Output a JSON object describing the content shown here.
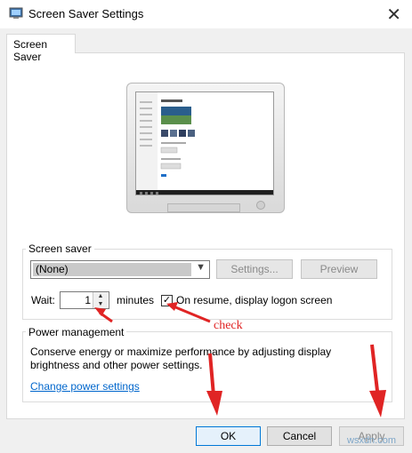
{
  "window": {
    "title": "Screen Saver Settings",
    "close_symbol": "✕"
  },
  "tabs": [
    {
      "label": "Screen Saver"
    }
  ],
  "screen_saver": {
    "group_label": "Screen saver",
    "selected_option": "(None)",
    "settings_label": "Settings...",
    "preview_label": "Preview",
    "wait_label": "Wait:",
    "wait_value": "1",
    "minutes_label": "minutes",
    "resume_checkbox_label": "On resume, display logon screen",
    "resume_checked": true
  },
  "power": {
    "group_label": "Power management",
    "description": "Conserve energy or maximize performance by adjusting display brightness and other power settings.",
    "link_label": "Change power settings"
  },
  "buttons": {
    "ok": "OK",
    "cancel": "Cancel",
    "apply": "Apply"
  },
  "annotation": {
    "check_text": "check",
    "color": "#e02424"
  },
  "watermark": "wsxdn.com"
}
